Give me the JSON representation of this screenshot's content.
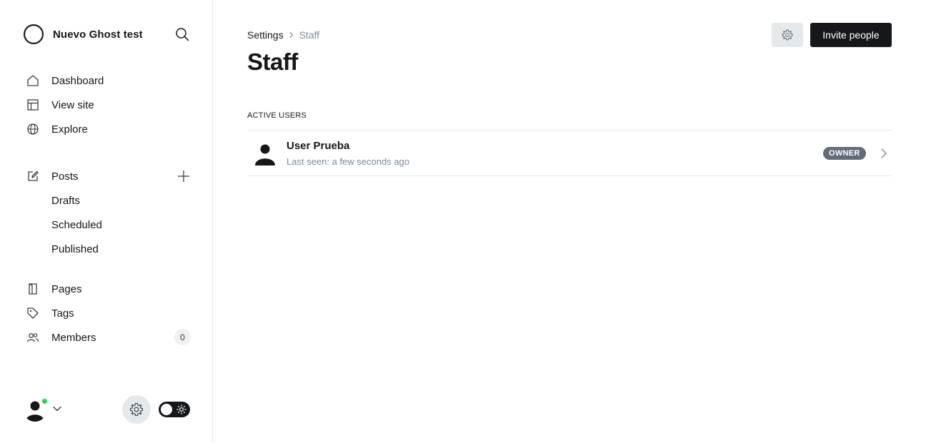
{
  "sidebar": {
    "site_title": "Nuevo Ghost test",
    "nav": {
      "dashboard": "Dashboard",
      "view_site": "View site",
      "explore": "Explore",
      "posts": "Posts",
      "drafts": "Drafts",
      "scheduled": "Scheduled",
      "published": "Published",
      "pages": "Pages",
      "tags": "Tags",
      "members": "Members",
      "members_count": "0"
    },
    "icons": [
      "ghost-logo-icon",
      "search-icon",
      "home-icon",
      "layout-icon",
      "globe-icon",
      "pencil-square-icon",
      "plus-icon",
      "page-icon",
      "tag-icon",
      "members-icon",
      "avatar-icon",
      "chevron-down-icon",
      "gear-icon",
      "sun-icon"
    ],
    "status_color": "#30cf43"
  },
  "header": {
    "breadcrumb_parent": "Settings",
    "breadcrumb_current": "Staff",
    "title": "Staff",
    "invite_label": "Invite people"
  },
  "staff": {
    "section_label": "Active users",
    "users": [
      {
        "name": "User Prueba",
        "last_seen": "Last seen: a few seconds ago",
        "role": "Owner"
      }
    ]
  },
  "colors": {
    "primary_button": "#15171a",
    "owner_badge": "#626d79",
    "muted_text": "#7c8b9a"
  }
}
